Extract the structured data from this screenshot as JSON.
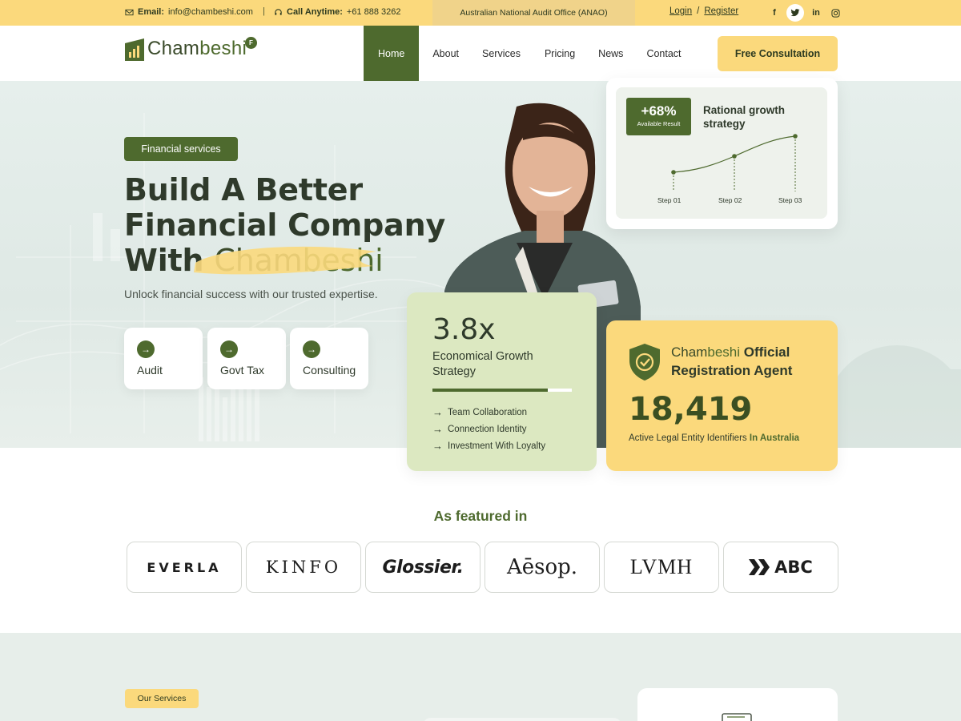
{
  "topbar": {
    "email_label": "Email:",
    "email_value": "info@chambeshi.com",
    "phone_label": "Call Anytime:",
    "phone_value": "+61 888 3262",
    "agency": "Australian National Audit Office (ANAO)",
    "login": "Login",
    "separator": "/",
    "register": "Register",
    "social": [
      "f",
      "twitter",
      "in",
      "instagram"
    ]
  },
  "brand": {
    "name_a": "Cham",
    "name_b": "beshi",
    "badge": "F"
  },
  "nav": {
    "items": [
      "Home",
      "About",
      "Services",
      "Pricing",
      "News",
      "Contact"
    ],
    "active": "Home",
    "cta": "Free Consultation"
  },
  "hero": {
    "pill": "Financial services",
    "line1": "Build A Better",
    "line2": "Financial Company",
    "line3_prefix": "With",
    "line3_a": "Cham",
    "line3_b": "beshi",
    "subtitle": "Unlock financial success with our trusted expertise.",
    "chips": [
      "Audit",
      "Govt Tax",
      "Consulting"
    ]
  },
  "growth_card": {
    "stat_value": "+68%",
    "stat_label": "Available Result",
    "title": "Rational growth strategy",
    "steps": [
      "Step 01",
      "Step 02",
      "Step 03"
    ]
  },
  "econ_card": {
    "value": "3.8x",
    "title": "Economical Growth Strategy",
    "progress": 0.83,
    "items": [
      "Team Collaboration",
      "Connection Identity",
      "Investment With Loyalty"
    ]
  },
  "reg_card": {
    "brand_a": "Cham",
    "brand_b": "beshi",
    "title_a": "Official",
    "title_b": "Registration Agent",
    "number": "18,419",
    "desc": "Active Legal Entity Identifiers",
    "desc_highlight": "In Australia"
  },
  "featured": {
    "title": "As featured in",
    "logos": [
      "EVERLA",
      "KINFO",
      "Glossier.",
      "Aēsop.",
      "LVMH",
      "ABC"
    ]
  },
  "services": {
    "tag": "Our Services"
  },
  "colors": {
    "primary": "#4e6a2e",
    "accent": "#fbd97c",
    "light_green": "#dce8c1"
  }
}
